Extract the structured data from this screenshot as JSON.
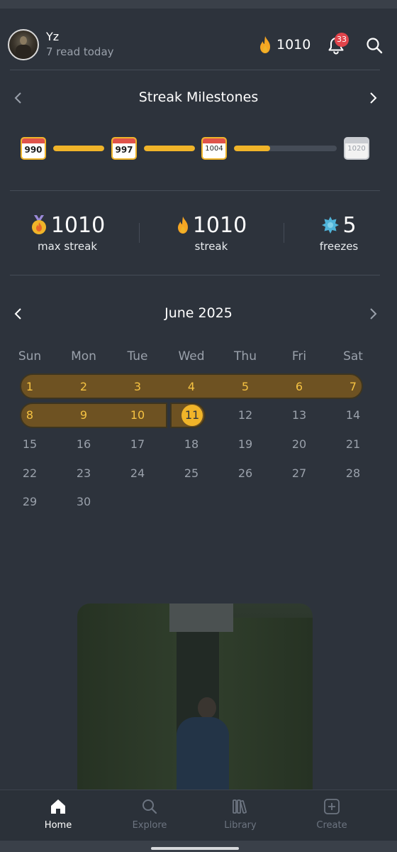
{
  "header": {
    "user_name": "Yz",
    "user_subtitle": "7 read today",
    "streak_count": "1010",
    "notification_count": "33"
  },
  "milestones": {
    "title": "Streak Milestones",
    "badges": [
      "990",
      "997",
      "1004",
      "1020"
    ],
    "progress": [
      1.0,
      1.0,
      0.35
    ]
  },
  "stats": {
    "max_streak": {
      "value": "1010",
      "label": "max streak"
    },
    "streak": {
      "value": "1010",
      "label": "streak"
    },
    "freezes": {
      "value": "5",
      "label": "freezes"
    }
  },
  "calendar": {
    "month_label": "June 2025",
    "weekdays": [
      "Sun",
      "Mon",
      "Tue",
      "Wed",
      "Thu",
      "Fri",
      "Sat"
    ],
    "days": [
      "1",
      "2",
      "3",
      "4",
      "5",
      "6",
      "7",
      "8",
      "9",
      "10",
      "11",
      "12",
      "13",
      "14",
      "15",
      "16",
      "17",
      "18",
      "19",
      "20",
      "21",
      "22",
      "23",
      "24",
      "25",
      "26",
      "27",
      "28",
      "29",
      "30"
    ],
    "today": "11",
    "streak_days": [
      "1",
      "2",
      "3",
      "4",
      "5",
      "6",
      "7",
      "8",
      "9",
      "10",
      "11"
    ]
  },
  "bottom_nav": {
    "items": [
      {
        "label": "Home",
        "icon": "home-icon",
        "active": true
      },
      {
        "label": "Explore",
        "icon": "search-icon",
        "active": false
      },
      {
        "label": "Library",
        "icon": "library-icon",
        "active": false
      },
      {
        "label": "Create",
        "icon": "plus-square-icon",
        "active": false
      }
    ]
  },
  "colors": {
    "background": "#2d333c",
    "accent": "#f0b429",
    "streak_band": "#6e5222",
    "muted_text": "#9aa1ab",
    "badge_red": "#e0444b"
  }
}
